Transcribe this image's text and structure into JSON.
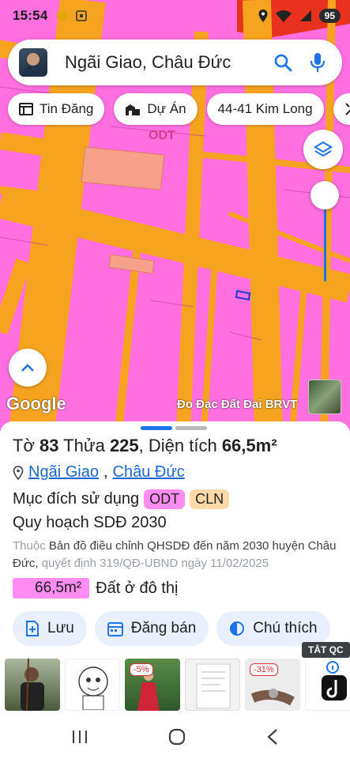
{
  "status": {
    "time": "15:54",
    "battery": "95"
  },
  "search": {
    "query": "Ngãi Giao, Châu Đức"
  },
  "chips": [
    {
      "label": "Tin Đăng",
      "icon": "list-icon"
    },
    {
      "label": "Dự Án",
      "icon": "building-icon"
    },
    {
      "label": "44-41 Kim Long",
      "icon": ""
    },
    {
      "label": "",
      "icon": "measure-icon"
    }
  ],
  "map": {
    "zone_label": "ODT",
    "google": "Google",
    "credit": "Đo Đạc Đất Đai BRVT"
  },
  "colors": {
    "land": "#ff6fe0",
    "road": "#f6a320",
    "accent": "#1a73e8",
    "chip_bg": "#e8f0fe"
  },
  "sheet": {
    "title_prefix": "Tờ ",
    "to": "83",
    "mid1": " Thửa ",
    "thua": "225",
    "mid2": ", Diện tích ",
    "area": "66,5m²",
    "location": {
      "commune": "Ngãi Giao",
      "sep": ",",
      "district": "Châu Đức"
    },
    "purpose_label": "Mục đích sử dụng",
    "tags": [
      "ODT",
      "CLN"
    ],
    "plan": "Quy hoạch SDĐ 2030",
    "desc_prefix": "Thuộc",
    "desc_main": "Bản đồ điều chỉnh QHSDĐ đến năm 2030 huyện Châu Đức,",
    "desc_tail": "quyết định 319/QĐ-UBND ngày 11/02/2025",
    "area_value": "66,5m²",
    "area_type": "Đất ở đô thị",
    "actions": [
      {
        "label": "Lưu",
        "icon": "save-plus-icon"
      },
      {
        "label": "Đăng bán",
        "icon": "calendar-icon"
      },
      {
        "label": "Chú thích",
        "icon": "contrast-icon"
      }
    ],
    "ads_close": "TẮT QC",
    "ad_discounts": [
      "-5%",
      "-31%"
    ]
  },
  "nav": {
    "recent": "|||",
    "home": "○",
    "back": "‹"
  }
}
